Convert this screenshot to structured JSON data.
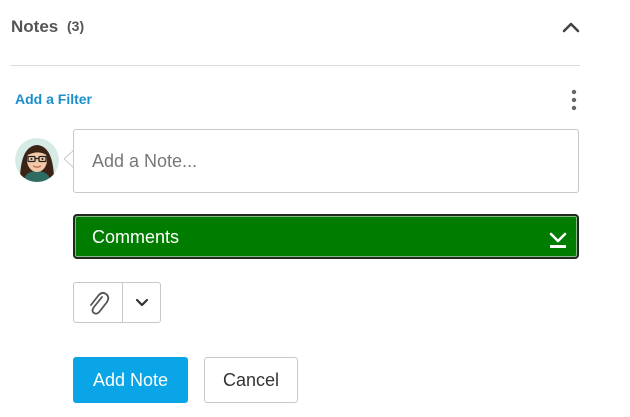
{
  "notes": {
    "title": "Notes",
    "count": "(3)"
  },
  "filter": {
    "label": "Add a Filter"
  },
  "composer": {
    "placeholder": "Add a Note...",
    "value": ""
  },
  "category": {
    "selected": "Comments",
    "color": "#007d00"
  },
  "actions": {
    "add_note": "Add Note",
    "cancel": "Cancel"
  },
  "colors": {
    "link": "#1a8fcc",
    "primary": "#0aa5e6"
  }
}
